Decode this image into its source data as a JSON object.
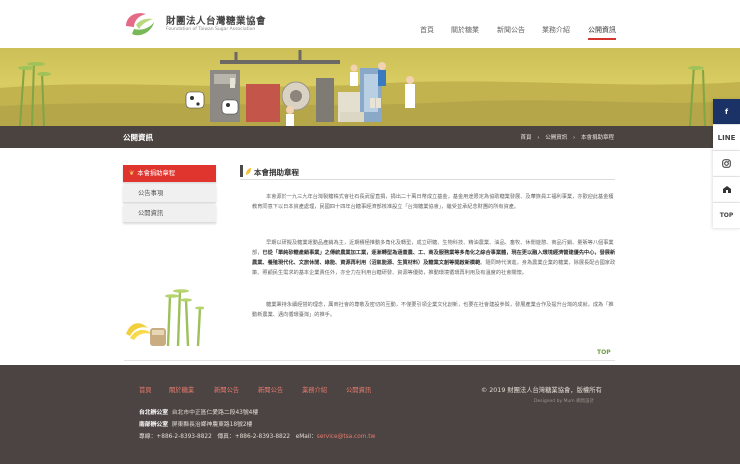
{
  "brand": {
    "name_cn": "財團法人台灣糖業協會",
    "name_en": "Foundation of Taiwan Sugar Association"
  },
  "nav": {
    "items": [
      "首頁",
      "關於糖業",
      "新聞公告",
      "業務介紹",
      "公開資訊"
    ],
    "active": "公開資訊"
  },
  "page": {
    "title": "公開資訊",
    "breadcrumb": [
      "首頁",
      "公開資訊",
      "本會捐助章程"
    ]
  },
  "sidebar": {
    "items": [
      "本會捐助章程",
      "公告事項",
      "公開資訊"
    ],
    "active_index": 0
  },
  "content": {
    "heading": "本會捐助章程",
    "p1": "本會源於一九三九年台灣製糖株式會社石長武留直捐，捐出二十萬日幣成立基金，基金用途限定為協助糖業發展、及華族員工福利事業，亦歡迎此基金獲教育同意下以日本資產處理，民國四十四年台糖事經濟部核准設立「台灣糖業協會」，繼受並承紀念財團的所有資產。",
    "p2_a": "早期以研擬及糖業運動品產銷為主，近期積極推動多角化及轉型，成立研糖、生物科技、精油農業、油品、畜牧、休閒遊憩、商品行銷、量販等八個事業部，",
    "p2_b": "已從「單純砂糖產銷事業」之傳統農業加工業，逐漸轉型為涵蓋農、工、商及服務業等多角化之綜合事業體，現在更以融入環境經濟營建優先中心，發展新農業、養殖現代化、文旅休閒、綠能、資源再利用（沼氣能源、生質材料）及糖業文創等開啟新模範",
    "p2_c": "。隨同時代演進，身為農業企業的糖業，除展長配合國家政策、照顧民生需求的基本企業責任外，亦全力在利用台糖研發、資源等優勢，推動環境循環再利用及有溫度的社會關懷。",
    "p3": "糖業秉持永續經營的理念，厲商社會的尊敬及密切的互動，不僅要引領企業文化創新，也要在社會建設參與，發展產業合作及提升台灣的成就，成為「推動新農業、邁向循環臺灣」的推手。"
  },
  "top_label": "TOP",
  "social": [
    "f",
    "LINE",
    "instagram-icon",
    "store-icon",
    "TOP"
  ],
  "footer": {
    "nav": [
      "首頁",
      "關於糖業",
      "新聞公告",
      "新聞公告",
      "業務介紹",
      "公開資訊"
    ],
    "copyright": "© 2019 財團法人台灣糖業協會，版權所有",
    "designed_by": "Designed by Mum 網頁設計",
    "north_label": "台北辦公室",
    "north_addr": "台北市中正區仁愛路二段43號4樓",
    "south_label": "南部辦公室",
    "south_addr": "屏東縣長治鄉神農東路18號2樓",
    "tel_label": "專線：",
    "tel": "+886-2-8393-8822",
    "fax_label": "傳真：",
    "fax": "+886-2-8393-8822",
    "email_label": "eMail：",
    "email": "service@tsa.com.tw"
  },
  "colors": {
    "accent_red": "#e0352f",
    "banner_yellow": "#d3c65e",
    "dark_bar": "#4a4340",
    "footer_bg": "#4b4442",
    "footer_link": "#e77a6d",
    "top_green": "#6f9a44",
    "facebook": "#1a3266"
  }
}
